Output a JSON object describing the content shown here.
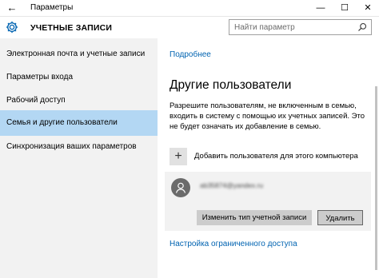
{
  "window": {
    "title": "Параметры",
    "back_glyph": "←",
    "minimize_glyph": "—",
    "maximize_glyph": "☐",
    "close_glyph": "✕"
  },
  "header": {
    "title": "УЧЕТНЫЕ ЗАПИСИ",
    "icon": "gear-icon"
  },
  "search": {
    "placeholder": "Найти параметр",
    "icon": "search-icon"
  },
  "sidebar": {
    "items": [
      {
        "label": "Электронная почта и учетные записи",
        "active": false
      },
      {
        "label": "Параметры входа",
        "active": false
      },
      {
        "label": "Рабочий доступ",
        "active": false
      },
      {
        "label": "Семья и другие пользователи",
        "active": true
      },
      {
        "label": "Синхронизация ваших параметров",
        "active": false
      }
    ]
  },
  "main": {
    "more_link": "Подробнее",
    "section_title": "Другие пользователи",
    "description": "Разрешите пользователям, не включенным в семью, входить в систему с помощью их учетных записей. Это не будет означать их добавление в семью.",
    "add_user_label": "Добавить пользователя для этого компьютера",
    "add_user_glyph": "+",
    "user": {
      "email": "ab35874@yandex.ru",
      "change_type_button": "Изменить тип учетной записи",
      "delete_button": "Удалить"
    },
    "restricted_access_link": "Настройка ограниченного доступа"
  },
  "colors": {
    "accent": "#0063b1",
    "sidebar_bg": "#f2f2f2",
    "active_item_bg": "#b3d7f3"
  }
}
